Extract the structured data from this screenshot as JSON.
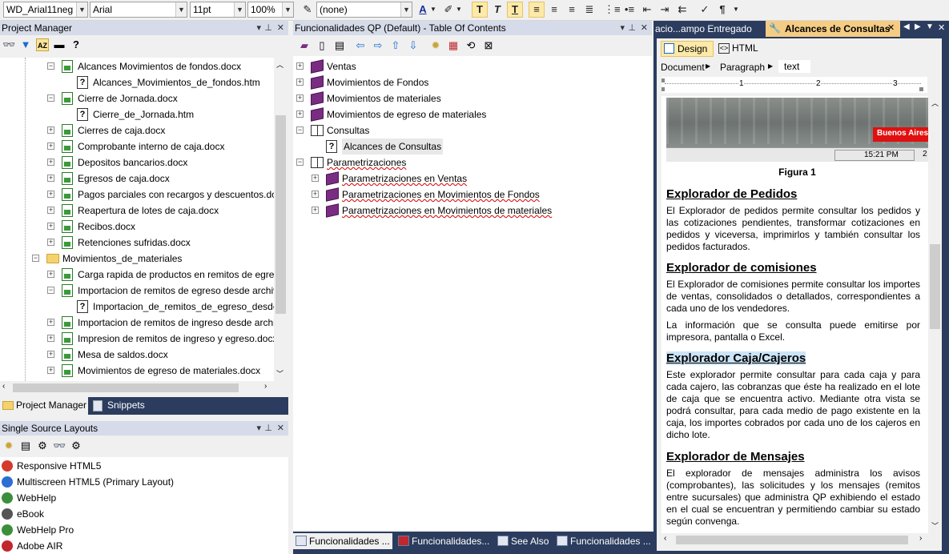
{
  "toolbar": {
    "style_value": "WD_Arial11neg",
    "font_value": "Arial",
    "size_value": "11pt",
    "zoom_value": "100%",
    "list_style_value": "(none)",
    "bold": "T",
    "italic": "T",
    "underline": "T",
    "pilcrow": "¶"
  },
  "project_manager": {
    "title": "Project Manager",
    "items": [
      {
        "label": "Alcances Movimientos de fondos.docx",
        "kind": "doc",
        "indent": 1,
        "expander": "−"
      },
      {
        "label": "Alcances_Movimientos_de_fondos.htm",
        "kind": "topic",
        "indent": 2,
        "expander": ""
      },
      {
        "label": "Cierre de Jornada.docx",
        "kind": "doc",
        "indent": 1,
        "expander": "−"
      },
      {
        "label": "Cierre_de_Jornada.htm",
        "kind": "topic",
        "indent": 2,
        "expander": ""
      },
      {
        "label": "Cierres de caja.docx",
        "kind": "doc",
        "indent": 1,
        "expander": "+"
      },
      {
        "label": "Comprobante interno de caja.docx",
        "kind": "doc",
        "indent": 1,
        "expander": "+"
      },
      {
        "label": "Depositos bancarios.docx",
        "kind": "doc",
        "indent": 1,
        "expander": "+"
      },
      {
        "label": "Egresos de caja.docx",
        "kind": "doc",
        "indent": 1,
        "expander": "+"
      },
      {
        "label": "Pagos parciales con recargos y descuentos.docx",
        "kind": "doc",
        "indent": 1,
        "expander": "+"
      },
      {
        "label": "Reapertura de lotes de caja.docx",
        "kind": "doc",
        "indent": 1,
        "expander": "+"
      },
      {
        "label": "Recibos.docx",
        "kind": "doc",
        "indent": 1,
        "expander": "+"
      },
      {
        "label": "Retenciones sufridas.docx",
        "kind": "doc",
        "indent": 1,
        "expander": "+"
      },
      {
        "label": "Movimientos_de_materiales",
        "kind": "folder",
        "indent": 0,
        "expander": "−"
      },
      {
        "label": "Carga rapida de productos en remitos de egreso.docx",
        "kind": "doc",
        "indent": 1,
        "expander": "+"
      },
      {
        "label": "Importacion de remitos de egreso desde archivos .docx",
        "kind": "doc",
        "indent": 1,
        "expander": "−"
      },
      {
        "label": "Importacion_de_remitos_de_egreso_desde_archivos",
        "kind": "topic",
        "indent": 2,
        "expander": ""
      },
      {
        "label": "Importacion de remitos de ingreso desde archivos.docx",
        "kind": "doc",
        "indent": 1,
        "expander": "+"
      },
      {
        "label": "Impresion de remitos de ingreso y egreso.docx",
        "kind": "doc",
        "indent": 1,
        "expander": "+"
      },
      {
        "label": "Mesa de saldos.docx",
        "kind": "doc",
        "indent": 1,
        "expander": "+"
      },
      {
        "label": "Movimientos de egreso de materiales.docx",
        "kind": "doc",
        "indent": 1,
        "expander": "+"
      }
    ],
    "tabs": [
      {
        "label": "Project Manager"
      },
      {
        "label": "Snippets"
      }
    ]
  },
  "layouts": {
    "title": "Single Source Layouts",
    "items": [
      {
        "label": "Responsive HTML5",
        "icon_color": "#d33a2c"
      },
      {
        "label": "Multiscreen HTML5 (Primary Layout)",
        "icon_color": "#2c6ed3"
      },
      {
        "label": "WebHelp",
        "icon_color": "#3b8f3b"
      },
      {
        "label": "eBook",
        "icon_color": "#555555"
      },
      {
        "label": "WebHelp Pro",
        "icon_color": "#3b8f3b"
      },
      {
        "label": "Adobe AIR",
        "icon_color": "#c1272d"
      }
    ]
  },
  "toc": {
    "title": "Funcionalidades QP (Default) - Table Of Contents",
    "items": [
      {
        "label": "Ventas",
        "kind": "book",
        "indent": 0,
        "expander": "+",
        "squiggle": false
      },
      {
        "label": "Movimientos de Fondos",
        "kind": "book",
        "indent": 0,
        "expander": "+",
        "squiggle": false
      },
      {
        "label": "Movimientos de materiales",
        "kind": "book",
        "indent": 0,
        "expander": "+",
        "squiggle": false
      },
      {
        "label": "Movimientos de egreso de materiales",
        "kind": "book",
        "indent": 0,
        "expander": "+",
        "squiggle": false
      },
      {
        "label": "Consultas",
        "kind": "bookopen",
        "indent": 0,
        "expander": "−",
        "squiggle": false
      },
      {
        "label": "Alcances de Consultas",
        "kind": "topic",
        "indent": 1,
        "expander": "",
        "squiggle": false
      },
      {
        "label": "Parametrizaciones",
        "kind": "bookopen",
        "indent": 0,
        "expander": "−",
        "squiggle": true
      },
      {
        "label": "Parametrizaciones en Ventas",
        "kind": "book",
        "indent": 1,
        "expander": "+",
        "squiggle": true
      },
      {
        "label": "Parametrizaciones en Movimientos de Fondos",
        "kind": "book",
        "indent": 1,
        "expander": "+",
        "squiggle": true
      },
      {
        "label": "Parametrizaciones en Movimientos de materiales",
        "kind": "book",
        "indent": 1,
        "expander": "+",
        "squiggle": true
      }
    ],
    "tabs": [
      {
        "label": "Funcionalidades ..."
      },
      {
        "label": "Funcionalidades..."
      },
      {
        "label": "See Also"
      },
      {
        "label": "Funcionalidades ..."
      }
    ]
  },
  "editor": {
    "tab_inactive": "acio...ampo Entregado",
    "tab_active": "Alcances de Consultas",
    "design_label": "Design",
    "html_label": "HTML",
    "crumbs": [
      "Document",
      "Paragraph",
      "text"
    ],
    "ruler_numbers": [
      "1",
      "2",
      "3"
    ],
    "image_overlay": "Buenos Aires S",
    "image_time": "15:21 PM",
    "image_time_suffix": "2",
    "figure_caption": "Figura 1",
    "sections": [
      {
        "heading": "Explorador de Pedidos",
        "paragraphs": [
          "El Explorador de pedidos permite consultar los pedidos y las cotizaciones pendientes, transformar cotizaciones en pedidos y viceversa, imprimirlos y también consultar los pedidos facturados."
        ]
      },
      {
        "heading": "Explorador de comisiones",
        "paragraphs": [
          "El Explorador de comisiones permite consultar los importes de ventas, consolidados o detallados, correspondientes a cada uno de los vendedores.",
          "La información que se consulta puede emitirse por impresora, pantalla o Excel."
        ]
      },
      {
        "heading": "Explorador Caja/Cajeros",
        "paragraphs": [
          "Este explorador permite consultar para cada caja y para cada cajero, las cobranzas que éste ha realizado en el lote de caja que se encuentra activo. Mediante otra vista se podrá consultar, para cada medio de pago existente en la caja, los importes cobrados por cada uno de los cajeros en dicho lote."
        ]
      },
      {
        "heading": "Explorador de Mensajes",
        "paragraphs": [
          "El explorador de mensajes administra los avisos (comprobantes), las solicitudes y los mensajes (remitos entre sucursales) que administra QP exhibiendo el estado en el cual se encuentran y permitiendo cambiar su estado según convenga."
        ]
      }
    ]
  },
  "colors": {
    "panel_header": "#d6dbe9",
    "heading_selected_bg": "#cce4f7",
    "image_overlay_red": "#e01010"
  }
}
